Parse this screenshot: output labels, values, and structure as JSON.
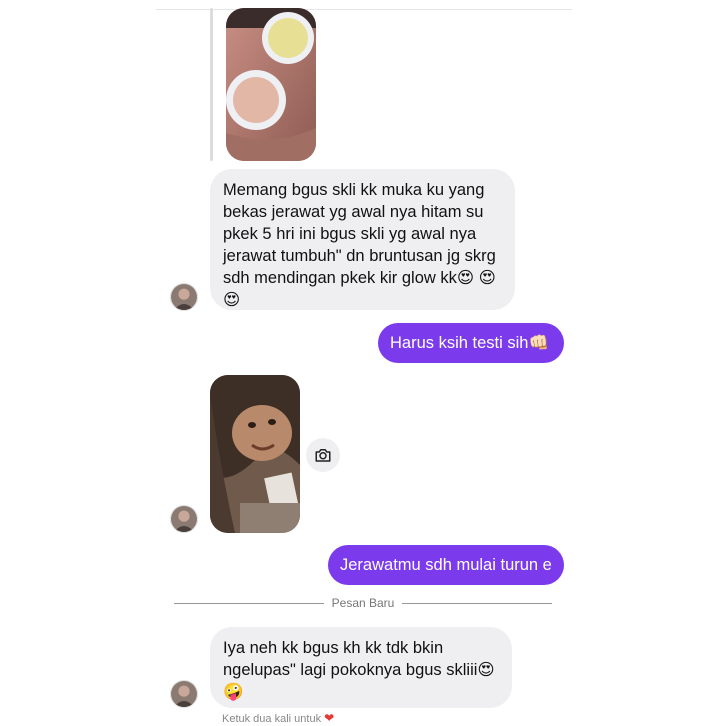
{
  "conversation": {
    "messages": [
      {
        "type": "text",
        "direction": "incoming",
        "lines": [
          "Memang bgus skli kk muka ku yang",
          "bekas jerawat yg awal nya hitam su",
          "pkek 5 hri ini bgus skli yg awal nya",
          "jerawat tumbuh\" dn bruntusan jg skrg",
          "sdh mendingan pkek kir glow kk😍 😍",
          "😍"
        ]
      },
      {
        "type": "text",
        "direction": "outgoing",
        "text": "Harus ksih testi sih👊🏻"
      },
      {
        "type": "photo",
        "direction": "incoming",
        "icon": "camera-icon"
      },
      {
        "type": "text",
        "direction": "outgoing",
        "text": "Jerawatmu sdh mulai turun e"
      },
      {
        "type": "text",
        "direction": "incoming",
        "lines": [
          "Iya neh kk bgus kh kk tdk bkin",
          "ngelupas\" lagi pokoknya bgus skliii😍",
          "🤪"
        ]
      }
    ],
    "divider_label": "Pesan Baru",
    "hint_text": "Ketuk dua kali untuk",
    "hint_icon": "heart-icon",
    "colors": {
      "outgoing_bubble": "#7c3aed",
      "incoming_bubble": "#efeff1"
    }
  }
}
